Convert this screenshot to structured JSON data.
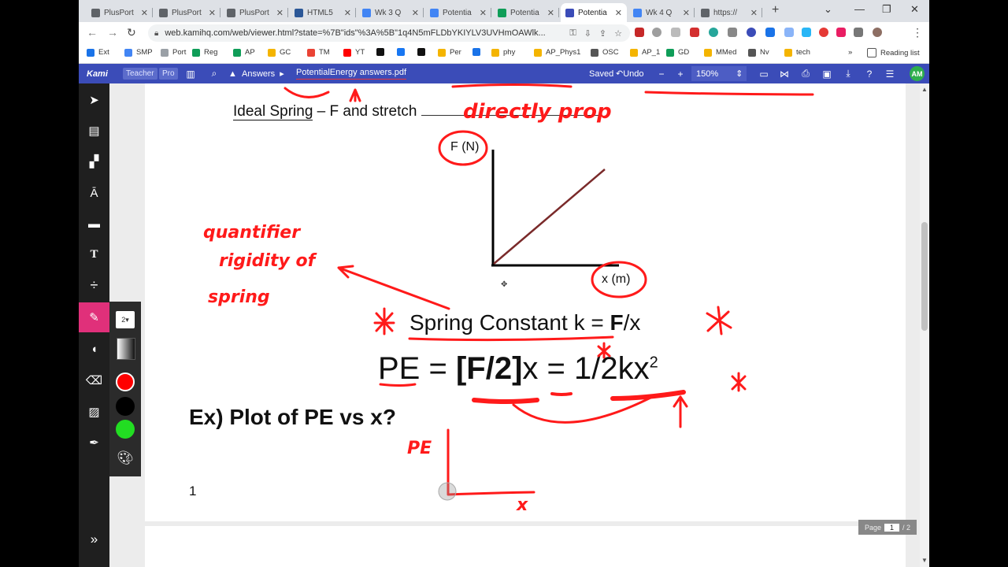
{
  "browser": {
    "tabs": [
      {
        "title": "PlusPort",
        "icon": "document-icon",
        "color": "#5f6368"
      },
      {
        "title": "PlusPort",
        "icon": "document-icon",
        "color": "#5f6368"
      },
      {
        "title": "PlusPort",
        "icon": "document-icon",
        "color": "#5f6368"
      },
      {
        "title": "HTML5",
        "icon": "html5-icon",
        "color": "#2b5797"
      },
      {
        "title": "Wk 3 Q",
        "icon": "docs-icon",
        "color": "#4285f4"
      },
      {
        "title": "Potentia",
        "icon": "docs-icon",
        "color": "#4285f4"
      },
      {
        "title": "Potentia",
        "icon": "drive-icon",
        "color": "#0f9d58"
      },
      {
        "title": "Potentia",
        "icon": "kami-icon",
        "color": "#3b4cb8"
      },
      {
        "title": "Wk 4 Q",
        "icon": "docs-icon",
        "color": "#4285f4"
      },
      {
        "title": "https://",
        "icon": "globe-icon",
        "color": "#5f6368"
      }
    ],
    "url": "web.kamihq.com/web/viewer.html?state=%7B\"ids\"%3A%5B\"1q4N5mFLDbYKIYLV3UVHmOAWlk...",
    "bookmarks": [
      {
        "label": "Ext",
        "color": "#1a73e8"
      },
      {
        "label": "SMP",
        "color": "#4285f4"
      },
      {
        "label": "Port",
        "color": "#9aa0a6"
      },
      {
        "label": "Reg",
        "color": "#0f9d58"
      },
      {
        "label": "AP",
        "color": "#0f9d58"
      },
      {
        "label": "GC",
        "color": "#f4b400"
      },
      {
        "label": "TM",
        "color": "#ea4335"
      },
      {
        "label": "YT",
        "color": "#ff0000"
      },
      {
        "label": "",
        "color": "#111111"
      },
      {
        "label": "",
        "color": "#1877f2"
      },
      {
        "label": "",
        "color": "#111111"
      },
      {
        "label": "Per",
        "color": "#f4b400"
      },
      {
        "label": "",
        "color": "#1a73e8"
      },
      {
        "label": "phy",
        "color": "#f4b400"
      },
      {
        "label": "AP_Phys1",
        "color": "#f4b400"
      },
      {
        "label": "OSC",
        "color": "#555555"
      },
      {
        "label": "AP_1",
        "color": "#f4b400"
      },
      {
        "label": "GD",
        "color": "#0f9d58"
      },
      {
        "label": "MMed",
        "color": "#f4b400"
      },
      {
        "label": "Nv",
        "color": "#555555"
      },
      {
        "label": "tech",
        "color": "#f4b400"
      }
    ],
    "more_bookmarks": "»",
    "reading_list": "Reading list"
  },
  "kami": {
    "logo": "Kami",
    "badge_teacher": "Teacher",
    "badge_pro": "Pro",
    "folder": "Answers",
    "file_name": "PotentialEnergy answers.pdf",
    "saved": "Saved",
    "undo": "Undo",
    "zoom": "150%",
    "avatar": "AM",
    "pen_size": "2",
    "colors": [
      "#ff0000",
      "#000000",
      "#22dd22"
    ]
  },
  "document": {
    "ideal_spring_prefix": "Ideal Spring",
    "ideal_spring_rest": " – F and stretch ",
    "axis_y": "F (N)",
    "axis_x": "x (m)",
    "spring_constant_lead": "Spring Constant k = ",
    "spring_constant_bold": "F",
    "spring_constant_tail": "/x",
    "pe_lead": "PE = ",
    "pe_bold": "[F/2]",
    "pe_mid": "x = 1/2kx",
    "pe_exp": "2",
    "example": "Ex) Plot of PE vs x?",
    "page_num": "1",
    "page_label": "Page",
    "page_current": "1",
    "page_total": "/ 2"
  },
  "handwriting": {
    "directly_prop": "directly prop",
    "quantifier_1": "quantifier",
    "quantifier_2": "rigidity of",
    "quantifier_3": "spring",
    "pe_axis": "PE",
    "x_axis": "x"
  }
}
